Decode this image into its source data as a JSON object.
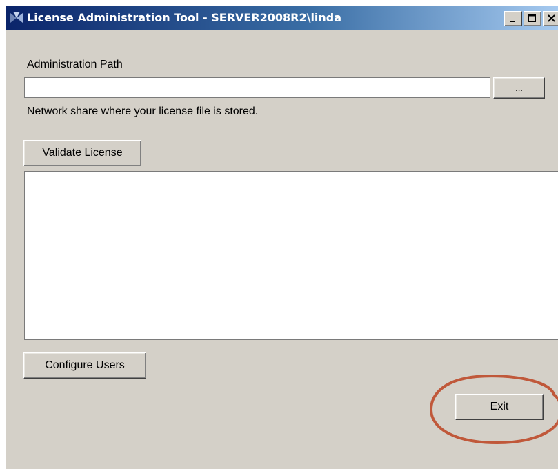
{
  "window": {
    "title": "License Administration Tool - SERVER2008R2\\linda",
    "icon": "app-logo-icon",
    "controls": [
      "minimize-icon",
      "maximize-icon",
      "close-icon"
    ]
  },
  "admin_path": {
    "label": "Administration Path",
    "value": "",
    "browse_label": "...",
    "hint": "Network share where your license file is stored."
  },
  "validate_label": "Validate License",
  "results": {
    "text": ""
  },
  "configure_users_label": "Configure Users",
  "exit_label": "Exit",
  "colors": {
    "window_background": "#d4d0c8",
    "title_bar_start": "#0a246a",
    "title_bar_end": "#a6caf0",
    "highlight_circle": "#c0583a"
  }
}
